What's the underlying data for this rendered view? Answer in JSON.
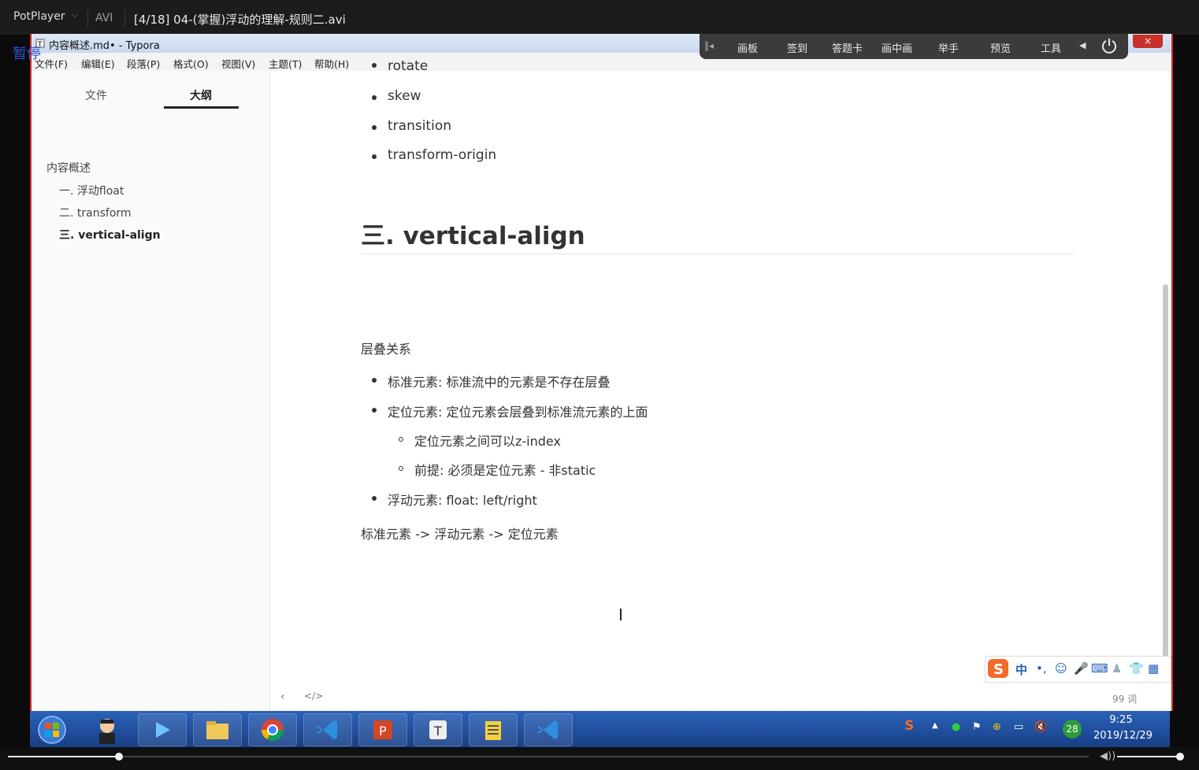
{
  "player": {
    "app_name": "PotPlayer",
    "format": "AVI",
    "file_title": "[4/18] 04-(掌握)浮动的理解-规则二.avi",
    "status": "暂停"
  },
  "class_toolbar": {
    "items": [
      "画板",
      "签到",
      "答题卡",
      "画中画",
      "举手",
      "预览",
      "工具"
    ]
  },
  "typora": {
    "window_title": "内容概述.md• - Typora",
    "close_label": "×",
    "menu": [
      "文件(F)",
      "编辑(E)",
      "段落(P)",
      "格式(O)",
      "视图(V)",
      "主题(T)",
      "帮助(H)"
    ],
    "sidebar": {
      "tabs": [
        "文件",
        "大纲"
      ],
      "active_tab": "大纲",
      "outline": [
        {
          "label": "内容概述",
          "level": 1
        },
        {
          "label": "一. 浮动float",
          "level": 2
        },
        {
          "label": "二. transform",
          "level": 2
        },
        {
          "label": "三. vertical-align",
          "level": 2,
          "active": true
        }
      ]
    },
    "content": {
      "partial_item": "rotate",
      "top_list": [
        "skew",
        "transition",
        "transform-origin"
      ],
      "heading": "三. vertical-align",
      "para1": "层叠关系",
      "list2": [
        "标准元素: 标准流中的元素是不存在层叠",
        "定位元素: 定位元素会层叠到标准流元素的上面",
        "浮动元素: float: left/right"
      ],
      "sublist": [
        "定位元素之间可以z-index",
        "前提: 必须是定位元素 - 非static"
      ],
      "para2": "标准元素 -> 浮动元素 -> 定位元素"
    },
    "footer": {
      "back": "‹",
      "code_toggle": "</>",
      "word_count": "99 词"
    }
  },
  "ime": {
    "mode": "中",
    "punct": "•,"
  },
  "taskbar": {
    "time": "9:25",
    "date": "2019/12/29",
    "badge": "28"
  },
  "colors": {
    "accent_red": "#e02020",
    "taskbar_blue": "#2b62b8",
    "text": "#333333"
  }
}
